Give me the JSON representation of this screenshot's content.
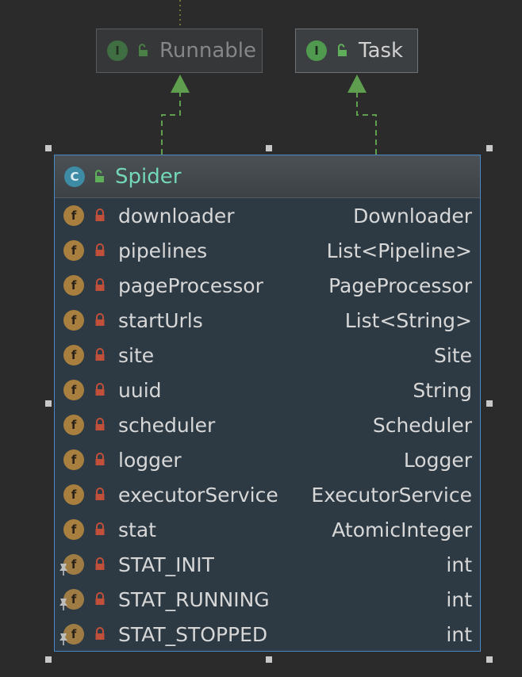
{
  "interfaces": [
    {
      "name": "Runnable",
      "kind_letter": "I",
      "icon": "interface-icon"
    },
    {
      "name": "Task",
      "kind_letter": "I",
      "icon": "interface-icon"
    }
  ],
  "class_box": {
    "name": "Spider",
    "kind_letter": "C",
    "icon": "class-icon",
    "fields": [
      {
        "name": "downloader",
        "type": "Downloader",
        "static": false
      },
      {
        "name": "pipelines",
        "type": "List<Pipeline>",
        "static": false
      },
      {
        "name": "pageProcessor",
        "type": "PageProcessor",
        "static": false
      },
      {
        "name": "startUrls",
        "type": "List<String>",
        "static": false
      },
      {
        "name": "site",
        "type": "Site",
        "static": false
      },
      {
        "name": "uuid",
        "type": "String",
        "static": false
      },
      {
        "name": "scheduler",
        "type": "Scheduler",
        "static": false
      },
      {
        "name": "logger",
        "type": "Logger",
        "static": false
      },
      {
        "name": "executorService",
        "type": "ExecutorService",
        "static": false
      },
      {
        "name": "stat",
        "type": "AtomicInteger",
        "static": false
      },
      {
        "name": "STAT_INIT",
        "type": "int",
        "static": true
      },
      {
        "name": "STAT_RUNNING",
        "type": "int",
        "static": true
      },
      {
        "name": "STAT_STOPPED",
        "type": "int",
        "static": true
      }
    ],
    "field_letter": "f",
    "field_icon": "field-icon",
    "lock_icon": "private-lock-icon",
    "static_marker_icon": "static-pin-icon"
  },
  "colors": {
    "background": "#2b2b2b",
    "class_title": "#74d7b6",
    "selection_border": "#4a88c7",
    "connector": "#5e9e4e",
    "private_lock": "#c0503a",
    "public_lock": "#5fae5a"
  }
}
